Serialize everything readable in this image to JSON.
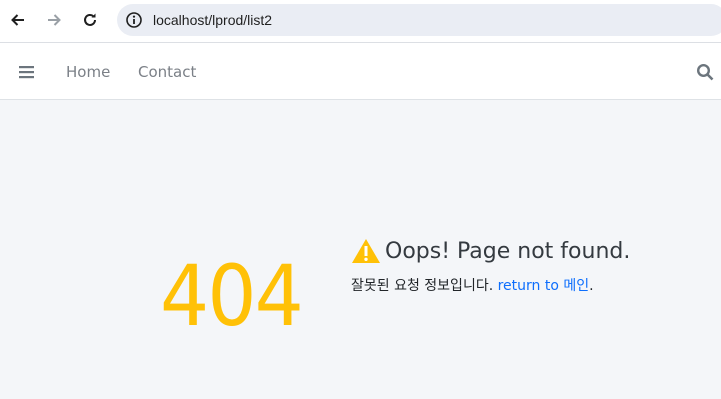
{
  "browser": {
    "url": "localhost/lprod/list2",
    "icons": {
      "back": "arrow-left-icon",
      "forward": "arrow-right-icon",
      "reload": "reload-icon",
      "site_info": "info-icon"
    }
  },
  "navbar": {
    "links": [
      {
        "label": "Home"
      },
      {
        "label": "Contact"
      }
    ],
    "icons": {
      "menu": "hamburger-icon",
      "search": "search-icon"
    }
  },
  "error": {
    "code": "404",
    "title": "Oops! Page not found.",
    "message": "잘못된 요청 정보입니다.",
    "link_text": "return to 메인",
    "suffix": ".",
    "icon": "warning-icon"
  },
  "colors": {
    "accent": "#ffc107",
    "link": "#0d6efd",
    "background": "#f4f6f9"
  }
}
